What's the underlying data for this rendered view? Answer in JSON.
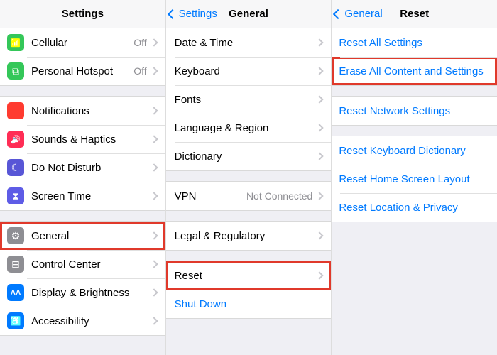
{
  "panel1": {
    "title": "Settings",
    "groups": [
      [
        {
          "icon": "cell",
          "bg": "green",
          "label": "Cellular",
          "detail": "Off"
        },
        {
          "icon": "link",
          "bg": "green",
          "label": "Personal Hotspot",
          "detail": "Off"
        }
      ],
      [
        {
          "icon": "notif",
          "bg": "red",
          "label": "Notifications"
        },
        {
          "icon": "sound",
          "bg": "pink",
          "label": "Sounds & Haptics"
        },
        {
          "icon": "moon",
          "bg": "purple",
          "label": "Do Not Disturb"
        },
        {
          "icon": "hour",
          "bg": "indigo",
          "label": "Screen Time"
        }
      ],
      [
        {
          "icon": "gear",
          "bg": "gray",
          "label": "General",
          "highlight": true
        },
        {
          "icon": "ctrl",
          "bg": "gray",
          "label": "Control Center"
        },
        {
          "icon": "disp",
          "bg": "blue",
          "label": "Display & Brightness"
        },
        {
          "icon": "acc",
          "bg": "blue",
          "label": "Accessibility"
        }
      ]
    ]
  },
  "panel2": {
    "back": "Settings",
    "title": "General",
    "groups": [
      [
        {
          "label": "Date & Time"
        },
        {
          "label": "Keyboard"
        },
        {
          "label": "Fonts"
        },
        {
          "label": "Language & Region"
        },
        {
          "label": "Dictionary"
        }
      ],
      [
        {
          "label": "VPN",
          "detail": "Not Connected"
        }
      ],
      [
        {
          "label": "Legal & Regulatory"
        }
      ],
      [
        {
          "label": "Reset",
          "highlight": true
        },
        {
          "label": "Shut Down",
          "link": true,
          "nochev": true
        }
      ]
    ]
  },
  "panel3": {
    "back": "General",
    "title": "Reset",
    "groups": [
      [
        {
          "label": "Reset All Settings",
          "link": true,
          "nochev": true
        },
        {
          "label": "Erase All Content and Settings",
          "link": true,
          "nochev": true,
          "highlight": true
        }
      ],
      [
        {
          "label": "Reset Network Settings",
          "link": true,
          "nochev": true
        }
      ],
      [
        {
          "label": "Reset Keyboard Dictionary",
          "link": true,
          "nochev": true
        },
        {
          "label": "Reset Home Screen Layout",
          "link": true,
          "nochev": true
        },
        {
          "label": "Reset Location & Privacy",
          "link": true,
          "nochev": true
        }
      ]
    ]
  }
}
